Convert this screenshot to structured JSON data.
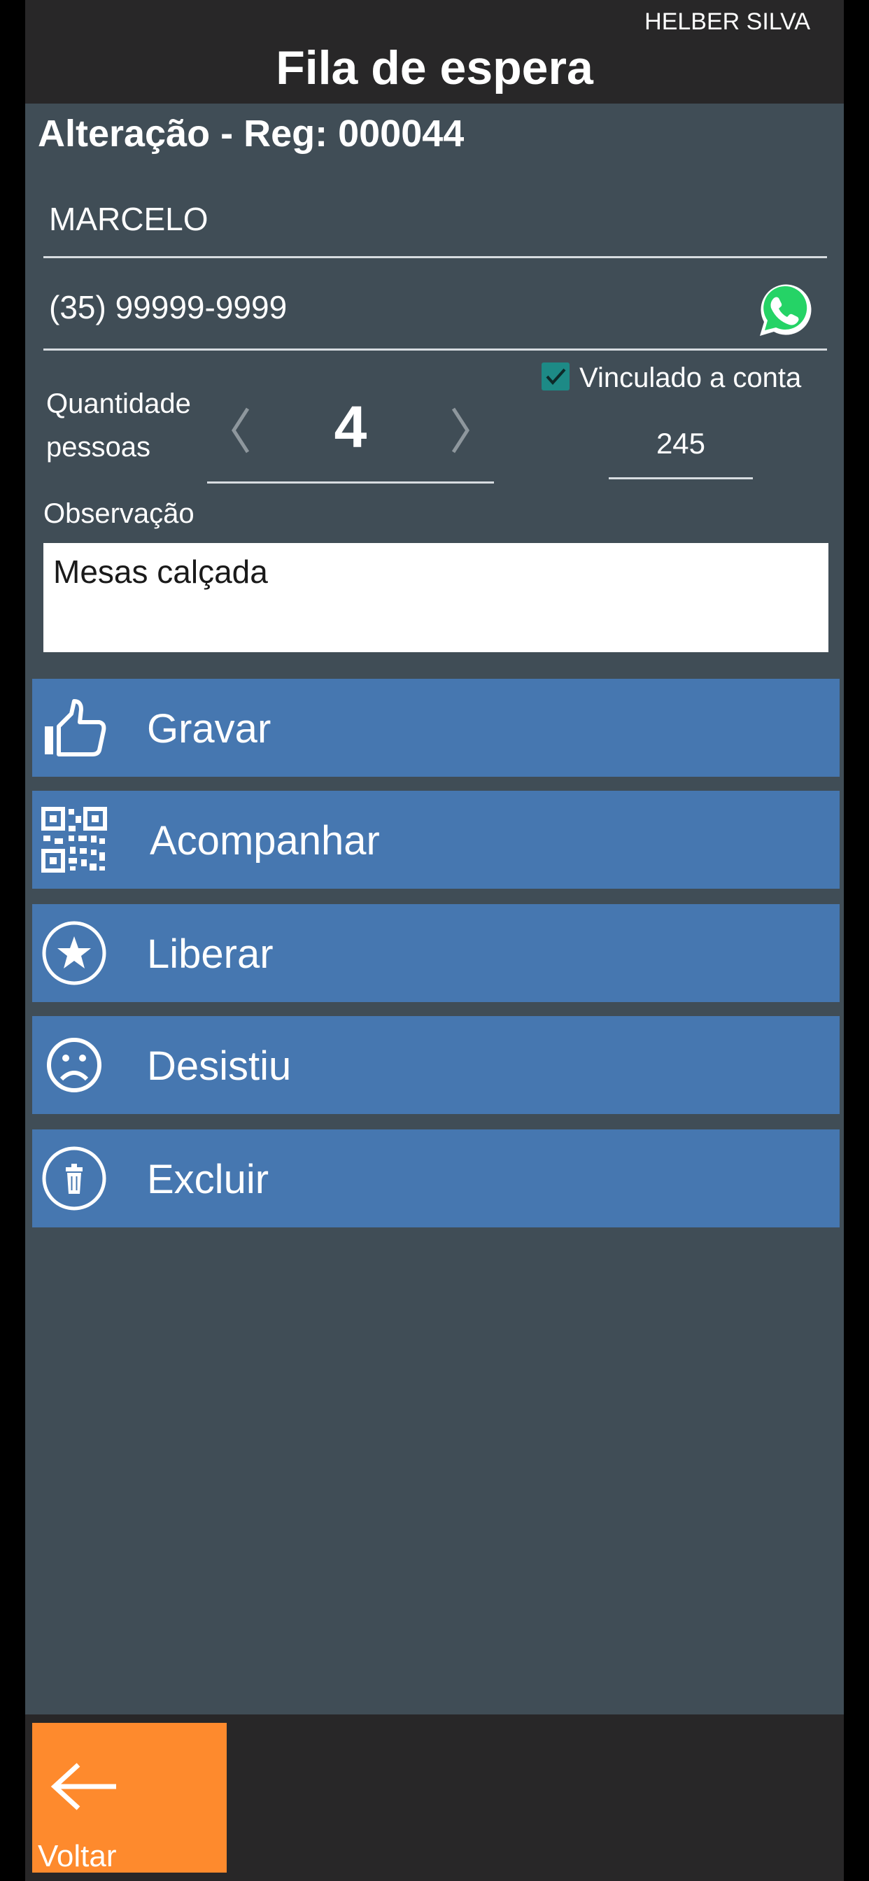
{
  "header": {
    "user": "HELBER SILVA",
    "title": "Fila de espera"
  },
  "record_title": "Alteração - Reg: 000044",
  "form": {
    "name": "MARCELO",
    "phone": "(35) 99999-9999",
    "quantity_label_1": "Quantidade",
    "quantity_label_2": "pessoas",
    "quantity": "4",
    "linked_label": "Vinculado a conta",
    "linked_checked": true,
    "account": "245",
    "observation_label": "Observação",
    "observation": "Mesas calçada"
  },
  "actions": [
    {
      "label": "Gravar",
      "icon": "thumbs-up-icon"
    },
    {
      "label": "Acompanhar",
      "icon": "qr-code-icon"
    },
    {
      "label": "Liberar",
      "icon": "star-circle-icon"
    },
    {
      "label": "Desistiu",
      "icon": "sad-face-icon"
    },
    {
      "label": "Excluir",
      "icon": "trash-circle-icon"
    }
  ],
  "footer": {
    "back_label": "Voltar"
  },
  "colors": {
    "header": "#282728",
    "body": "#404d56",
    "button": "#4677b0",
    "back": "#fe8a2d",
    "checkbox": "#1d8a86",
    "whatsapp": "#25d366"
  }
}
